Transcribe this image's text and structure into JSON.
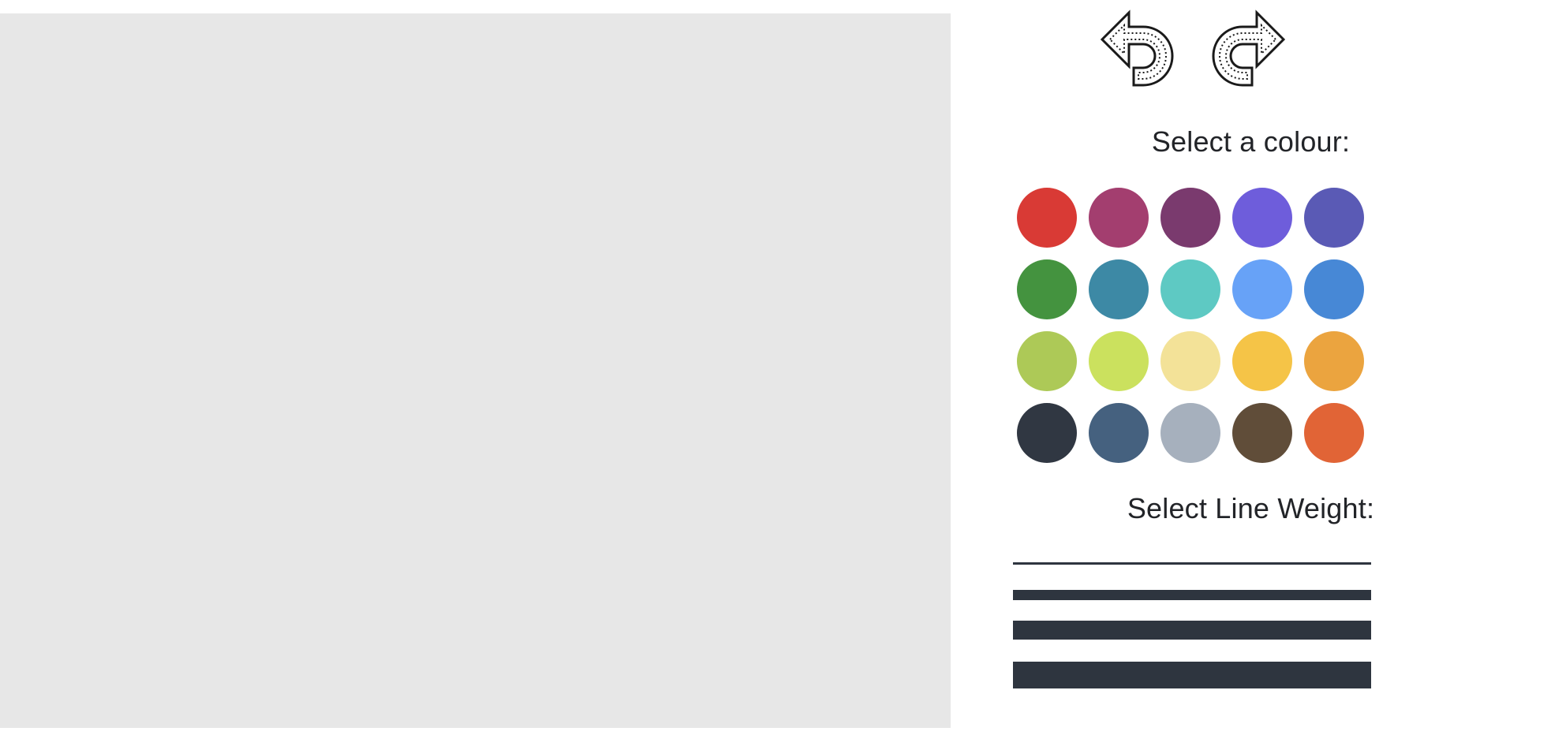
{
  "canvas": {
    "background": "#e7e7e7"
  },
  "toolbar": {
    "undo_icon": "undo-arrow-icon",
    "redo_icon": "redo-arrow-icon"
  },
  "colour_picker": {
    "title": "Select a colour:",
    "swatches": [
      "#d93a35",
      "#a33e6f",
      "#7a3a6e",
      "#6e5ddb",
      "#5a5ab5",
      "#44933f",
      "#3d89a5",
      "#5ec9c3",
      "#67a2f7",
      "#4788d6",
      "#adc957",
      "#cbe15e",
      "#f3e298",
      "#f5c447",
      "#eba43f",
      "#303742",
      "#45617f",
      "#a6b0bd",
      "#604d39",
      "#e16436"
    ]
  },
  "line_weight": {
    "title": "Select Line Weight:",
    "options": [
      1,
      2,
      3,
      4
    ],
    "color": "#2e353f"
  }
}
